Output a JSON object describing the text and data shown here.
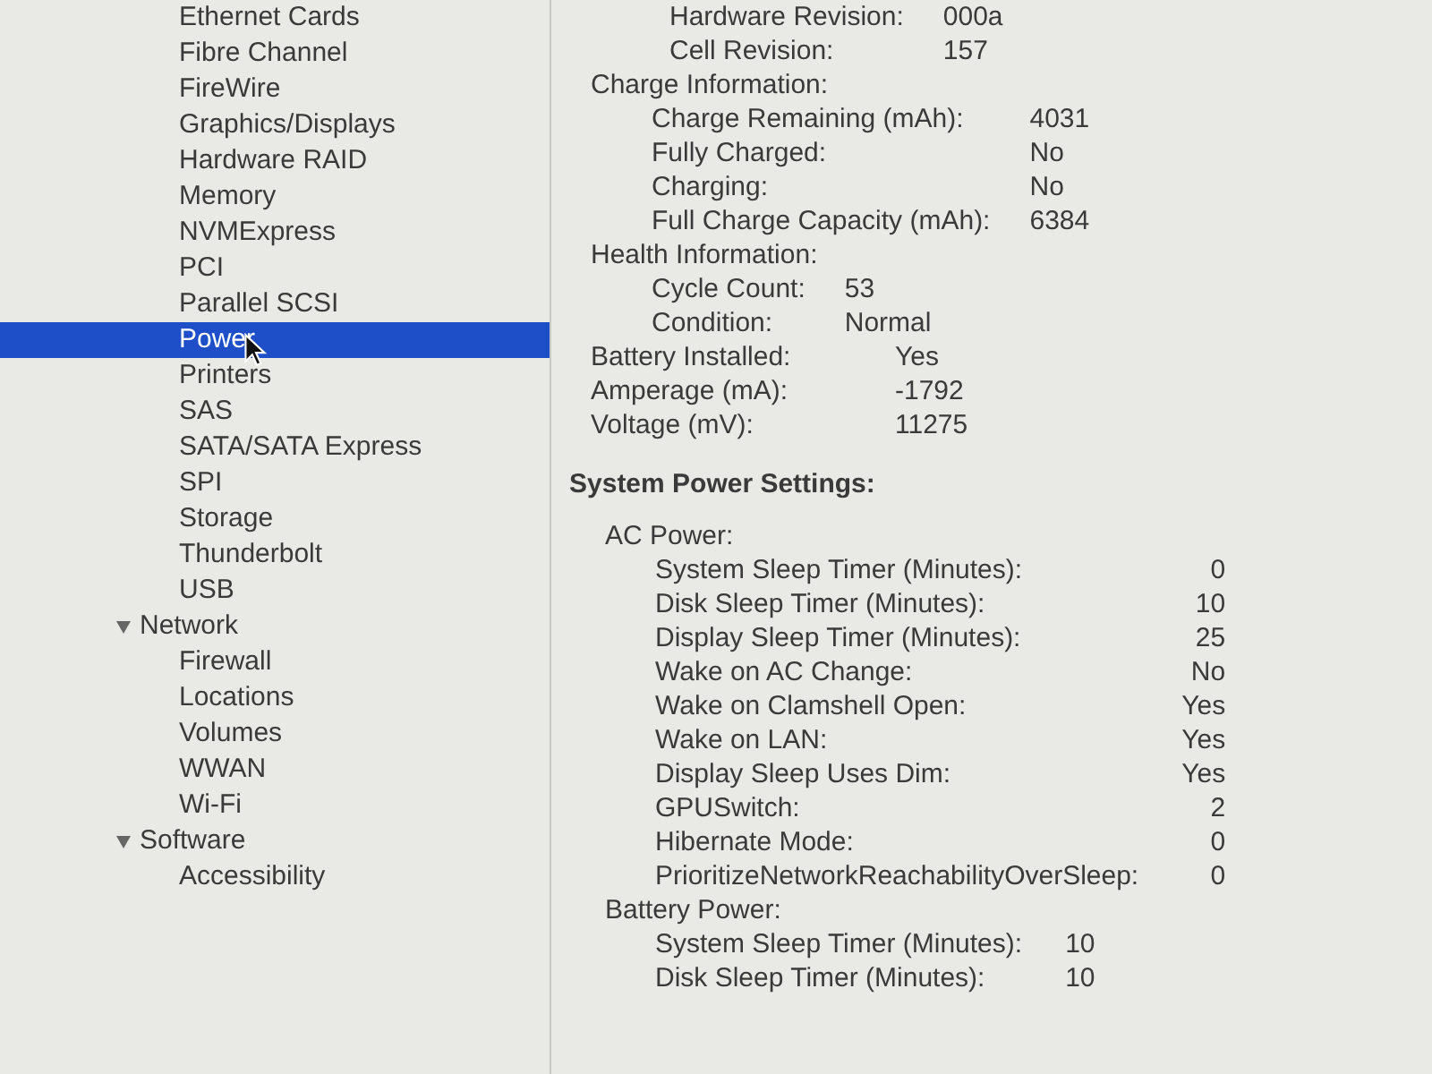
{
  "sidebar": {
    "items": [
      {
        "kind": "item",
        "label": "Ethernet Cards",
        "selected": false
      },
      {
        "kind": "item",
        "label": "Fibre Channel",
        "selected": false
      },
      {
        "kind": "item",
        "label": "FireWire",
        "selected": false
      },
      {
        "kind": "item",
        "label": "Graphics/Displays",
        "selected": false
      },
      {
        "kind": "item",
        "label": "Hardware RAID",
        "selected": false
      },
      {
        "kind": "item",
        "label": "Memory",
        "selected": false
      },
      {
        "kind": "item",
        "label": "NVMExpress",
        "selected": false
      },
      {
        "kind": "item",
        "label": "PCI",
        "selected": false
      },
      {
        "kind": "item",
        "label": "Parallel SCSI",
        "selected": false
      },
      {
        "kind": "item",
        "label": "Power",
        "selected": true
      },
      {
        "kind": "item",
        "label": "Printers",
        "selected": false
      },
      {
        "kind": "item",
        "label": "SAS",
        "selected": false
      },
      {
        "kind": "item",
        "label": "SATA/SATA Express",
        "selected": false
      },
      {
        "kind": "item",
        "label": "SPI",
        "selected": false
      },
      {
        "kind": "item",
        "label": "Storage",
        "selected": false
      },
      {
        "kind": "item",
        "label": "Thunderbolt",
        "selected": false
      },
      {
        "kind": "item",
        "label": "USB",
        "selected": false
      },
      {
        "kind": "group",
        "label": "Network",
        "expanded": true,
        "children": [
          {
            "label": "Firewall",
            "selected": false
          },
          {
            "label": "Locations",
            "selected": false
          },
          {
            "label": "Volumes",
            "selected": false
          },
          {
            "label": "WWAN",
            "selected": false
          },
          {
            "label": "Wi-Fi",
            "selected": false
          }
        ]
      },
      {
        "kind": "group",
        "label": "Software",
        "expanded": true,
        "children": [
          {
            "label": "Accessibility",
            "selected": false
          }
        ]
      }
    ]
  },
  "battery_details": [
    {
      "kind": "group",
      "children": [
        {
          "label": "Hardware Revision:",
          "value": "000a"
        },
        {
          "label": "Cell Revision:",
          "value": "157"
        }
      ]
    },
    {
      "kind": "group",
      "label": "Charge Information:",
      "children": [
        {
          "label": "Charge Remaining (mAh):",
          "value": "4031"
        },
        {
          "label": "Fully Charged:",
          "value": "No"
        },
        {
          "label": "Charging:",
          "value": "No"
        },
        {
          "label": "Full Charge Capacity (mAh):",
          "value": "6384"
        }
      ]
    },
    {
      "kind": "group",
      "label": "Health Information:",
      "children": [
        {
          "label": "Cycle Count:",
          "value": "53"
        },
        {
          "label": "Condition:",
          "value": "Normal"
        }
      ]
    },
    {
      "kind": "row",
      "label": "Battery Installed:",
      "value": "Yes"
    },
    {
      "kind": "row",
      "label": "Amperage (mA):",
      "value": "-1792"
    },
    {
      "kind": "row",
      "label": "Voltage (mV):",
      "value": "11275"
    }
  ],
  "power_settings": {
    "title": "System Power Settings:",
    "items": [
      {
        "kind": "group",
        "label": "AC Power:",
        "children": [
          {
            "label": "System Sleep Timer (Minutes):",
            "value": "0"
          },
          {
            "label": "Disk Sleep Timer (Minutes):",
            "value": "10"
          },
          {
            "label": "Display Sleep Timer (Minutes):",
            "value": "25"
          },
          {
            "label": "Wake on AC Change:",
            "value": "No"
          },
          {
            "label": "Wake on Clamshell Open:",
            "value": "Yes"
          },
          {
            "label": "Wake on LAN:",
            "value": "Yes"
          },
          {
            "label": "Display Sleep Uses Dim:",
            "value": "Yes"
          },
          {
            "label": "GPUSwitch:",
            "value": "2"
          },
          {
            "label": "Hibernate Mode:",
            "value": "0"
          },
          {
            "label": "PrioritizeNetworkReachabilityOverSleep:",
            "value": "0"
          }
        ]
      },
      {
        "kind": "group",
        "label": "Battery Power:",
        "children": [
          {
            "label": "System Sleep Timer (Minutes):",
            "value": "10"
          },
          {
            "label": "Disk Sleep Timer (Minutes):",
            "value": "10"
          }
        ]
      }
    ]
  }
}
